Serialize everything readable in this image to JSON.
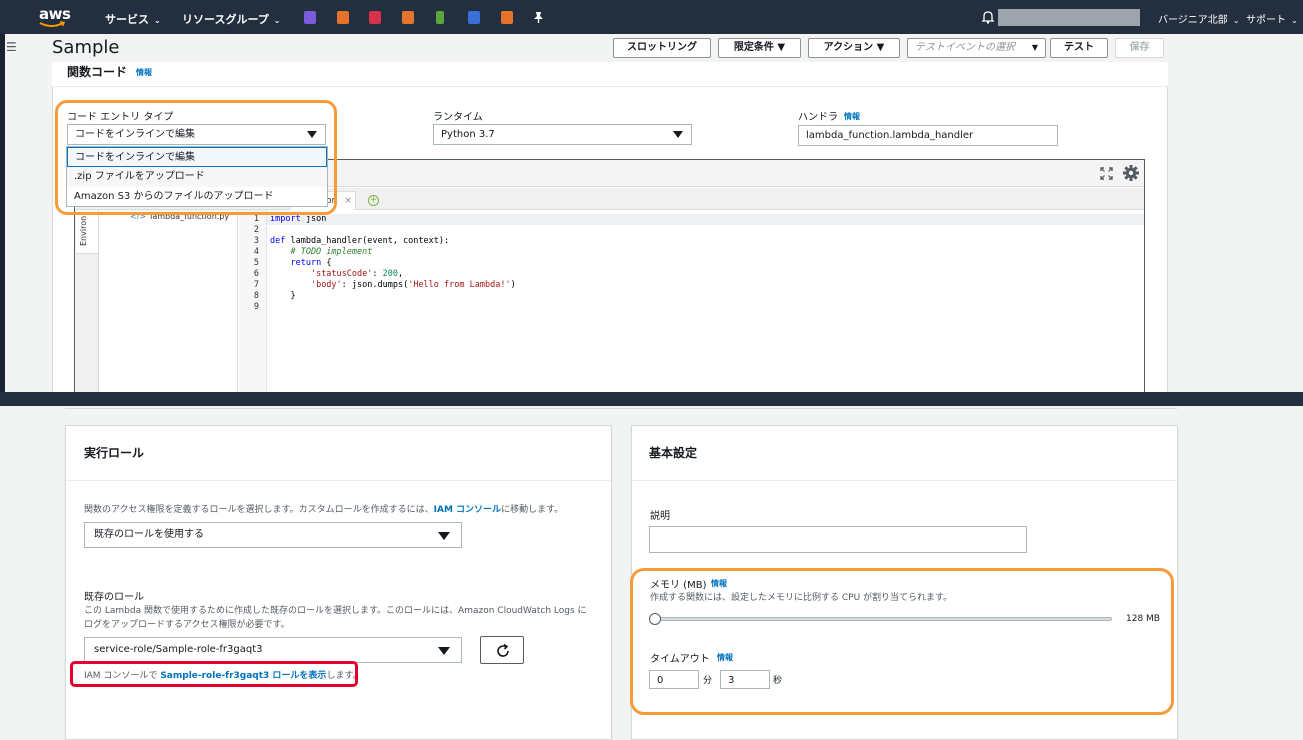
{
  "topnav": {
    "brand": "aws",
    "services_menu": "サービス",
    "resource_groups_menu": "リソースグループ",
    "region_menu": "バージニア北部",
    "support_menu": "サポート",
    "pinned_service_colors": [
      "#7b5bdc",
      "#e5732a",
      "#d6334a",
      "#e5732a",
      "#5aa63c",
      "#3b6fd8",
      "#e5732a"
    ]
  },
  "header": {
    "title": "Sample",
    "buttons": {
      "throttle": "スロットリング",
      "qualifier": "限定条件",
      "actions": "アクション",
      "test": "テスト",
      "save": "保存"
    },
    "test_event_placeholder": "テストイベントの選択"
  },
  "function_code": {
    "title": "関数コード",
    "info": "情報",
    "entry_type_label": "コード エントリ タイプ",
    "entry_type_value": "コードをインラインで編集",
    "entry_type_options": [
      "コードをインラインで編集",
      ".zip ファイルをアップロード",
      "Amazon S3 からのファイルのアップロード"
    ],
    "runtime_label": "ランタイム",
    "runtime_value": "Python 3.7",
    "handler_label": "ハンドラ",
    "handler_info": "情報",
    "handler_value": "lambda_function.lambda_handler"
  },
  "editor": {
    "tab_label": "ction",
    "tab_close": "×",
    "env_label": "Environ",
    "file_name": "lambda_function.py",
    "line_numbers": [
      "1",
      "2",
      "3",
      "4",
      "5",
      "6",
      "7",
      "8",
      "9"
    ],
    "lines": {
      "l1_kw": "import",
      "l1_rest": " json",
      "l3_kw": "def",
      "l3_rest": " lambda_handler(event, context):",
      "l4": "    # TODO implement",
      "l5_indent": "    ",
      "l5_kw": "return",
      "l5_rest": " {",
      "l6_indent": "        ",
      "l6_key": "'statusCode'",
      "l6_colon": ": ",
      "l6_num": "200",
      "l6_end": ",",
      "l7_indent": "        ",
      "l7_key": "'body'",
      "l7_mid": ": json.dumps(",
      "l7_str": "'Hello from Lambda!'",
      "l7_end": ")",
      "l8": "    }"
    }
  },
  "execution_role": {
    "title": "実行ロール",
    "desc_before": "関数のアクセス権限を定義するロールを選択します。カスタムロールを作成するには、",
    "desc_link": "IAM コンソール",
    "desc_after": "に移動します。",
    "role_mode_value": "既存のロールを使用する",
    "existing_role_label": "既存のロール",
    "existing_role_desc_line1": "この Lambda 関数で使用するために作成した既存のロールを選択します。このロールには、Amazon CloudWatch Logs に",
    "existing_role_desc_line2": "ログをアップロードするアクセス権限が必要です。",
    "existing_role_value": "service-role/Sample-role-fr3gaqt3",
    "iam_prefix": "IAM コンソールで ",
    "iam_link": "Sample-role-fr3gaqt3 ロールを表示",
    "iam_suffix": "します。"
  },
  "basic_settings": {
    "title": "基本設定",
    "description_label": "説明",
    "description_value": "",
    "memory_label": "メモリ (MB)",
    "memory_info": "情報",
    "memory_help": "作成する関数には、設定したメモリに比例する CPU が割り当てられます。",
    "memory_value": "128 MB",
    "memory_slider_fraction": 0,
    "timeout_label": "タイムアウト",
    "timeout_info": "情報",
    "timeout_minutes": "0",
    "minutes_unit": "分",
    "timeout_seconds": "3",
    "seconds_unit": "秒"
  },
  "highlight_colors": {
    "orange": "#f79a3a",
    "red": "#e4002b"
  }
}
